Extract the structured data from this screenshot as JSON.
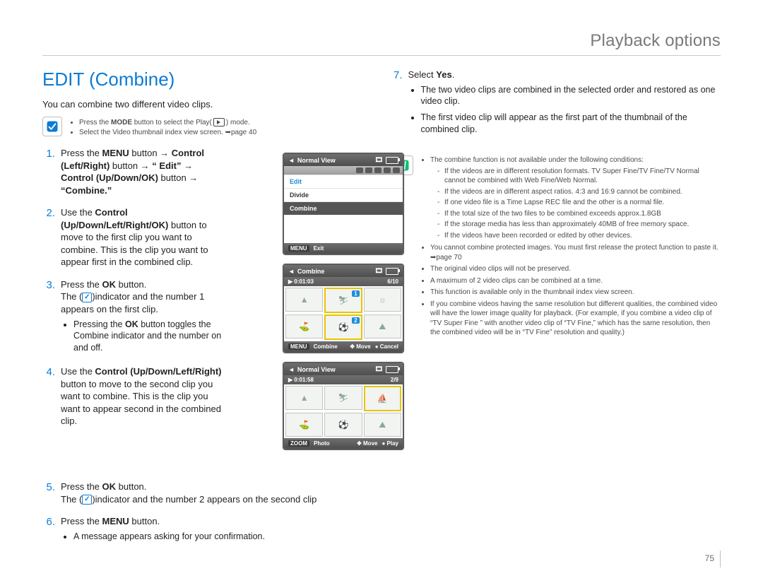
{
  "header": {
    "title": "Playback options"
  },
  "section_title": "EDIT (Combine)",
  "intro": "You can combine two different video clips.",
  "top_callout": {
    "items": [
      "Press the MODE button to select the Play( ▶ ) mode.",
      "Select the Video thumbnail index view screen. ➥page 40"
    ]
  },
  "steps": [
    {
      "n": "1",
      "html": "Press the <b>MENU</b> button → <b>Control (Left/Right)</b> button → <b>“ Edit”</b> → <b>Control (Up/Down/OK)</b> button → <b>“Combine.”</b>"
    },
    {
      "n": "2",
      "html": "Use the <b>Control (Up/Down/Left/Right/OK)</b> button to move to the first clip you want to combine. This is the clip you want to appear first in the combined clip."
    },
    {
      "n": "3",
      "html": "Press the <b>OK</b> button.<br>The (<span class=\"icon-check\">✓</span>)indicator and the number 1 appears on the first clip.",
      "sub": [
        "Pressing the <b>OK</b> button toggles the Combine indicator and the number on and off."
      ]
    },
    {
      "n": "4",
      "html": "Use the <b>Control (Up/Down/Left/Right)</b> button to move to the second clip you want to combine. This is the clip you want to appear second in the combined clip."
    },
    {
      "n": "5",
      "html": "Press the <b>OK</b> button.<br>The (<span class=\"icon-check\">✓</span>)indicator and the number 2 appears on the second clip"
    },
    {
      "n": "6",
      "html": "Press the <b>MENU</b> button.",
      "sub": [
        "A message appears asking for your confirmation."
      ]
    }
  ],
  "right_step": {
    "n": "7",
    "lead": "Select ",
    "yes": "Yes",
    "items": [
      "The two video clips are combined in the selected order and restored as one video clip.",
      "The first video clip will appear as the first part of the thumbnail of the combined clip."
    ]
  },
  "fine_print": {
    "lead": "The combine function is not available under the following conditions:",
    "conditions": [
      "If the videos are in different resolution formats. TV Super Fine/TV Fine/TV Normal cannot be combined with Web Fine/Web Normal.",
      "If the videos are in different aspect ratios. 4:3 and 16:9 cannot be combined.",
      "If one video file is a Time Lapse REC file and the other is a normal file.",
      "If the total size of the two files to be combined exceeds approx.1.8GB",
      "If the storage media has less than approximately 40MB of free memory space.",
      "If the videos have been recorded or edited by other devices."
    ],
    "more": [
      "You cannot combine protected images. You must first release the protect function to paste it. ➥page 70",
      "The original video clips will not be preserved.",
      "A maximum of 2 video clips can be combined at a time.",
      "This function is available only in the thumbnail index view screen.",
      "If you combine videos having the same resolution but different qualities, the combined video will have the lower image quality for playback. (For example, if you combine a video clip of “TV Super Fine ” with another video clip of “TV Fine,” which has the same resolution, then the combined video will be in “TV Fine” resolution and quality.)"
    ]
  },
  "screens": {
    "s1": {
      "title": "Normal View",
      "rows": [
        "Edit",
        "Divide",
        "Combine"
      ],
      "foot_left_key": "MENU",
      "foot_left": "Exit"
    },
    "s2": {
      "title": "Combine",
      "time": "0:01:03",
      "count": "6/10",
      "foot_key": "MENU",
      "foot1": "Combine",
      "foot2": "Move",
      "foot3": "Cancel",
      "badge1": "1",
      "badge2": "2"
    },
    "s3": {
      "title": "Normal View",
      "time": "0:01:58",
      "count": "2/9",
      "foot_key": "ZOOM",
      "foot1": "Photo",
      "foot2": "Move",
      "foot3": "Play"
    }
  },
  "page_number": "75",
  "chart_data": null
}
